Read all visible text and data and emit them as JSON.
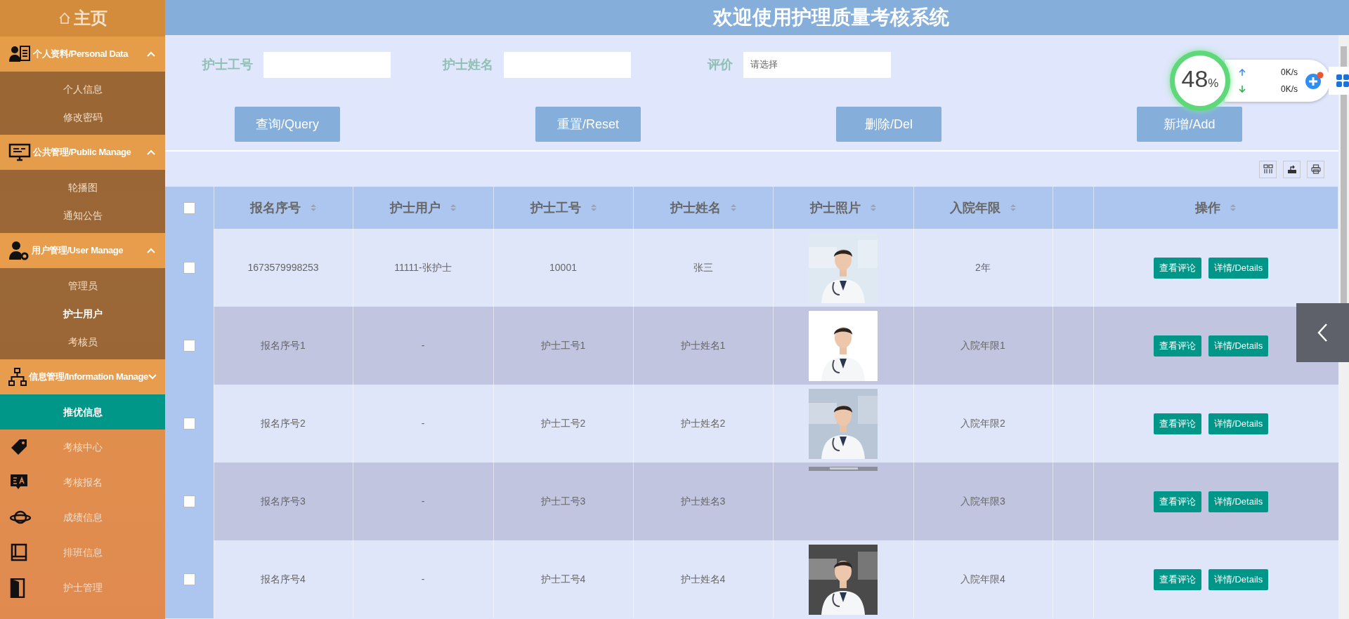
{
  "sidebar": {
    "home": "主页",
    "groups": [
      {
        "label": "个人资料/Personal Data",
        "expanded": true,
        "items": [
          {
            "label": "个人信息",
            "hovered": false
          },
          {
            "label": "修改密码",
            "hovered": false
          }
        ]
      },
      {
        "label": "公共管理/Public Manage",
        "expanded": true,
        "items": [
          {
            "label": "轮播图",
            "hovered": false
          },
          {
            "label": "通知公告",
            "hovered": false
          }
        ]
      },
      {
        "label": "用户管理/User Manage",
        "expanded": true,
        "items": [
          {
            "label": "管理员",
            "hovered": false
          },
          {
            "label": "护士用户",
            "hovered": true
          },
          {
            "label": "考核员",
            "hovered": false
          }
        ]
      },
      {
        "label": "信息管理/Information Manage",
        "expanded": false
      }
    ],
    "links": [
      {
        "label": "推优信息",
        "kind": "plain",
        "selected": true
      },
      {
        "label": "考核中心",
        "kind": "icon",
        "selected": false
      },
      {
        "label": "考核报名",
        "kind": "icon",
        "selected": false
      },
      {
        "label": "成绩信息",
        "kind": "icon",
        "selected": false
      },
      {
        "label": "排班信息",
        "kind": "icon",
        "selected": false
      },
      {
        "label": "护士管理",
        "kind": "icon",
        "selected": false
      }
    ]
  },
  "header": {
    "title": "欢迎使用护理质量考核系统"
  },
  "filters": [
    {
      "label": "护士工号",
      "kind": "text"
    },
    {
      "label": "护士姓名",
      "kind": "text"
    },
    {
      "label": "评价",
      "kind": "select",
      "placeholder": "请选择"
    }
  ],
  "buttons": [
    "查询/Query",
    "重置/Reset",
    "删除/Del",
    "新增/Add"
  ],
  "table": {
    "all_selected": false,
    "columns": [
      {
        "label": "报名序号",
        "kind": "sort"
      },
      {
        "label": "护士用户",
        "kind": "sort"
      },
      {
        "label": "护士工号",
        "kind": "sort"
      },
      {
        "label": "护士姓名",
        "kind": "sort"
      },
      {
        "label": "护士照片",
        "kind": "sort"
      },
      {
        "label": "入院年限",
        "kind": "sort"
      },
      {
        "kind": "spacer"
      },
      {
        "label": "操作",
        "kind": "sort"
      }
    ],
    "rows": [
      {
        "selected": false,
        "cells": [
          "1673579998253",
          "11111-张护士",
          "10001",
          "张三"
        ],
        "photo": {
          "kind": "picture"
        },
        "years": "2年",
        "actions": [
          "查看评论",
          "详情/Details"
        ]
      },
      {
        "selected": false,
        "cells": [
          "报名序号1",
          "-",
          "护士工号1",
          "护士姓名1"
        ],
        "photo": {
          "kind": "picture"
        },
        "years": "入院年限1",
        "actions": [
          "查看评论",
          "详情/Details"
        ]
      },
      {
        "selected": false,
        "cells": [
          "报名序号2",
          "-",
          "护士工号2",
          "护士姓名2"
        ],
        "photo": {
          "kind": "picture"
        },
        "years": "入院年限2",
        "actions": [
          "查看评论",
          "详情/Details"
        ]
      },
      {
        "selected": false,
        "cells": [
          "报名序号3",
          "-",
          "护士工号3",
          "护士姓名3"
        ],
        "photo": {
          "kind": "strip"
        },
        "years": "入院年限3",
        "actions": [
          "查看评论",
          "详情/Details"
        ]
      },
      {
        "selected": false,
        "cells": [
          "报名序号4",
          "-",
          "护士工号4",
          "护士姓名4"
        ],
        "photo": {
          "kind": "picture"
        },
        "years": "入院年限4",
        "actions": [
          "查看评论",
          "详情/Details"
        ]
      }
    ]
  },
  "speed_widget": {
    "percent": "48",
    "unit": "%",
    "upload": "0K/s",
    "download": "0K/s"
  }
}
